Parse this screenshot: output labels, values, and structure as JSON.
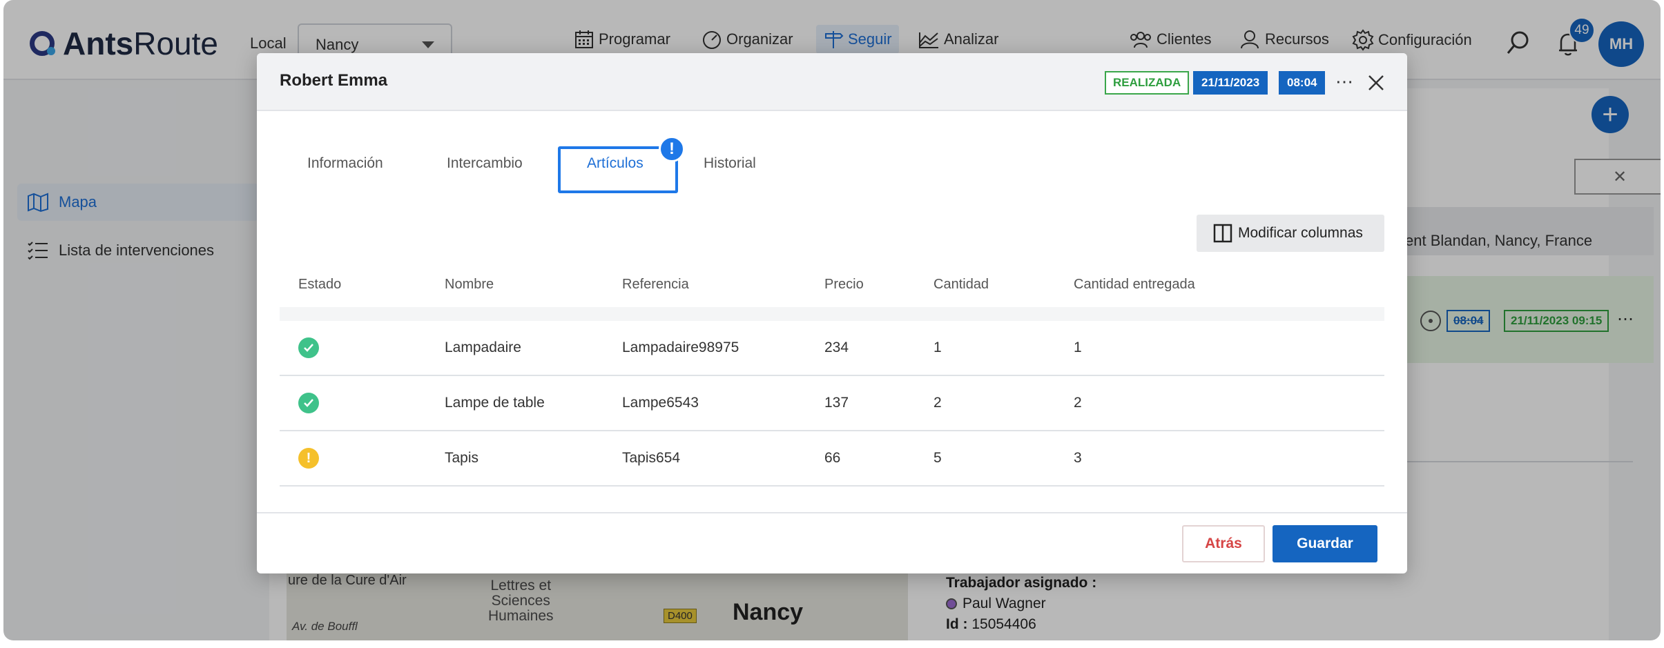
{
  "app": {
    "logo_text_bold": "Ants",
    "logo_text_regular": "Route",
    "local_label": "Local",
    "local_value": "Nancy",
    "nav": [
      "Programar",
      "Organizar",
      "Seguir",
      "Analizar"
    ],
    "right_nav": [
      "Clientes",
      "Recursos",
      "Configuración"
    ],
    "notifications_count": "49",
    "avatar_initials": "MH"
  },
  "sidebar": {
    "items": [
      {
        "label": "Mapa",
        "active": true
      },
      {
        "label": "Lista de intervenciones",
        "active": false
      }
    ]
  },
  "background": {
    "address": "ent Blandan, Nancy, France",
    "time_struck": "08:04",
    "date_done": "21/11/2023 09:15",
    "map_text_1": "ure de la Cure d'Air",
    "map_text_2": "Lettres et\nSciences\nHumaines",
    "map_city": "Nancy",
    "map_road": "D400",
    "map_street": "Av. de Bouffl",
    "assigned_label": "Trabajador asignado :",
    "assigned_worker": "Paul Wagner",
    "id_label": "Id :",
    "id_value": "15054406"
  },
  "modal": {
    "title": "Robert Emma",
    "status": "REALIZADA",
    "date": "21/11/2023",
    "time": "08:04",
    "tabs": [
      {
        "label": "Información",
        "active": false
      },
      {
        "label": "Intercambio",
        "active": false
      },
      {
        "label": "Artículos",
        "active": true
      },
      {
        "label": "Historial",
        "active": false
      }
    ],
    "alert_mark": "!",
    "modify_columns": "Modificar columnas",
    "columns": [
      "Estado",
      "Nombre",
      "Referencia",
      "Precio",
      "Cantidad",
      "Cantidad entregada"
    ],
    "rows": [
      {
        "state": "ok",
        "name": "Lampadaire",
        "ref": "Lampadaire98975",
        "price": "234",
        "qty": "1",
        "delivered": "1"
      },
      {
        "state": "ok",
        "name": "Lampe de table",
        "ref": "Lampe6543",
        "price": "137",
        "qty": "2",
        "delivered": "2"
      },
      {
        "state": "warn",
        "name": "Tapis",
        "ref": "Tapis654",
        "price": "66",
        "qty": "5",
        "delivered": "3"
      }
    ],
    "back_label": "Atrás",
    "save_label": "Guardar"
  },
  "colors": {
    "primary": "#1565c0",
    "accent": "#1e78e8",
    "success": "#3fc28a",
    "warning": "#f5c02b",
    "danger": "#d64545"
  }
}
